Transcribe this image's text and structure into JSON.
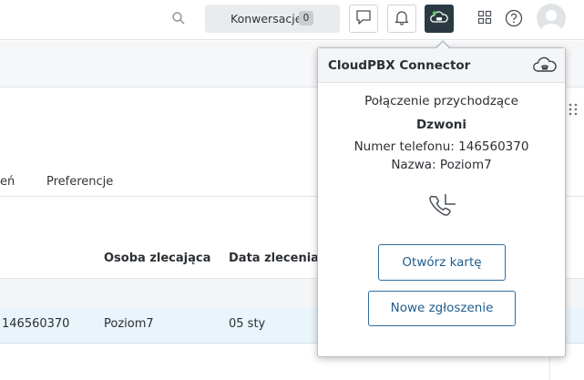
{
  "topbar": {
    "search_icon": "search-icon",
    "conversations_label": "Konwersacje",
    "conversations_count": "0",
    "chat_icon": "chat-icon",
    "bell_icon": "bell-icon",
    "pbx_icon": "cloud-phone-icon",
    "apps_icon": "apps-grid-icon",
    "help_icon": "help-icon",
    "avatar_icon": "user-avatar-icon"
  },
  "page": {
    "tab_truncated": "eń",
    "tab_preferences": "Preferencje",
    "table": {
      "headers": [
        "Osoba zlecająca",
        "Data zlecenia"
      ],
      "row": [
        "146560370",
        "Poziom7",
        "05 sty"
      ]
    }
  },
  "popup": {
    "title": "CloudPBX Connector",
    "header_icon": "cloud-phone-icon",
    "call_type": "Połączenie przychodzące",
    "status": "Dzwoni",
    "phone": "Numer telefonu: 146560370",
    "name": "Nazwa: Poziom7",
    "call_icon": "incoming-call-icon",
    "open_card_label": "Otwórz kartę",
    "new_ticket_label": "Nowe zgłoszenie"
  },
  "colors": {
    "accent": "#1f5c8e",
    "pbx_button": "#2b3a42",
    "row_highlight": "#eaf4fb"
  }
}
